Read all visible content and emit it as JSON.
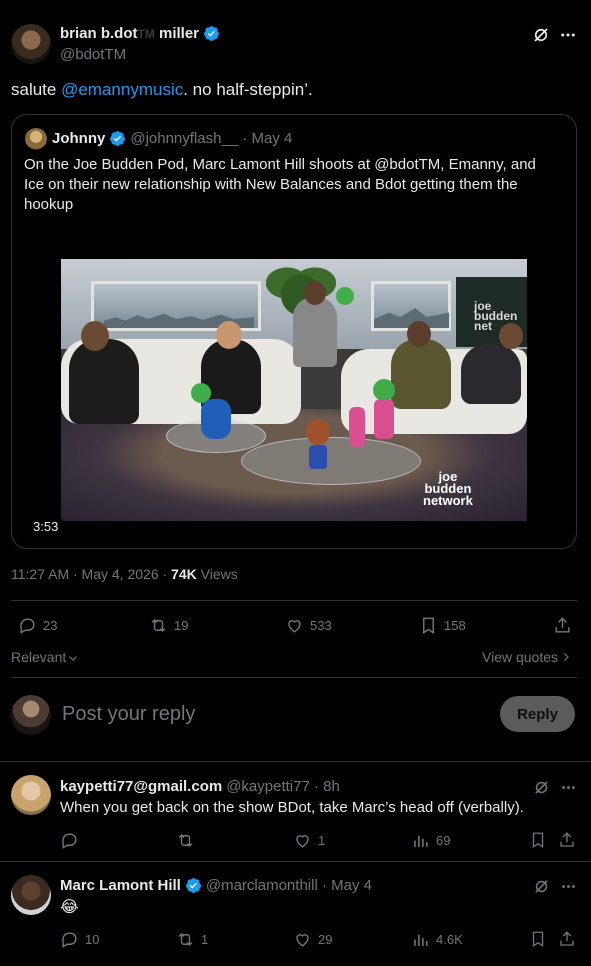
{
  "post": {
    "author_name_part1": "brian b.dot",
    "author_tm": "TM",
    "author_name_part2": " miller",
    "handle": "@bdotTM",
    "text_prefix": "salute ",
    "mention": "@emannymusic",
    "text_suffix": ". no half-steppin’.",
    "timestamp": "11:27 AM · May 4, 2026 · ",
    "views_count": "74K",
    "views_label": " Views"
  },
  "quote": {
    "author_name": "Johnny",
    "handle": "@johnnyflash__",
    "date": " · May 4",
    "text": "On the Joe Budden Pod, Marc Lamont Hill shoots at @bdotTM, Emanny, and Ice on their new relationship with New Balances and Bdot getting them the hookup",
    "video_duration": "3:53",
    "video_watermark": [
      "joe",
      "budden",
      "network"
    ],
    "wall_sign": [
      "joe",
      "budden",
      "net"
    ]
  },
  "actions": {
    "replies": "23",
    "reposts": "19",
    "likes": "533",
    "bookmarks": "158"
  },
  "sort": {
    "label": "Relevant",
    "view_quotes": "View quotes"
  },
  "composer": {
    "placeholder": "Post your reply",
    "button": "Reply"
  },
  "replies": [
    {
      "name": "kaypetti77@gmail.com",
      "handle": "@kaypetti77",
      "time": " · 8h",
      "text": "When you get back on the show BDot, take Marc’s head off (verbally).",
      "replies": "",
      "reposts": "",
      "likes": "1",
      "views": "69"
    },
    {
      "name": "Marc Lamont Hill",
      "handle": "@marclamonthill",
      "time": " · May 4",
      "text": "😂",
      "replies": "10",
      "reposts": "1",
      "likes": "29",
      "views": "4.6K"
    }
  ],
  "colors": {
    "background": "#000000",
    "text": "#e7e9ea",
    "secondary": "#71767b",
    "accent": "#1d9bf0",
    "border": "#2f3336"
  }
}
